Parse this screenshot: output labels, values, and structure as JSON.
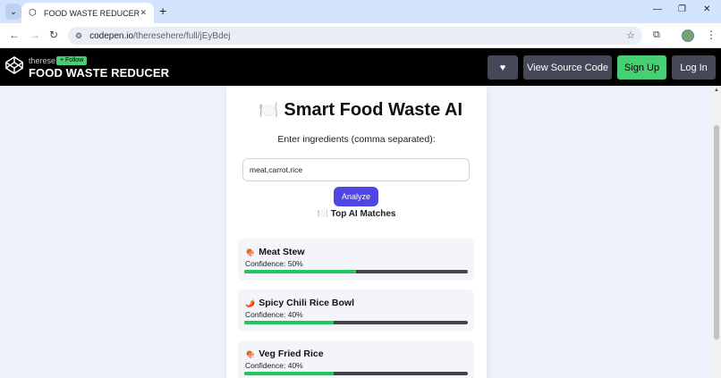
{
  "browser": {
    "tab_title": "FOOD WASTE REDUCER",
    "url_host": "codepen.io",
    "url_path": "/theresehere/full/jEyBdej"
  },
  "header": {
    "username": "therese",
    "follow_label": "+ Follow",
    "pen_title": "FOOD WASTE REDUCER",
    "view_source_label": "View Source Code",
    "signup_label": "Sign Up",
    "login_label": "Log In"
  },
  "app": {
    "title_emoji": "🍽️",
    "title": "Smart Food Waste AI",
    "prompt": "Enter ingredients (comma separated):",
    "input_value": "meat,carrot,rice",
    "analyze_label": "Analyze",
    "matches_title": "🍽️ Top AI Matches",
    "results": [
      {
        "icon": "🍖",
        "name": "Meat Stew",
        "confidence_text": "Confidence: 50%",
        "confidence": 0.5
      },
      {
        "icon": "🌶️",
        "name": "Spicy Chili Rice Bowl",
        "confidence_text": "Confidence: 40%",
        "confidence": 0.4
      },
      {
        "icon": "🍖",
        "name": "Veg Fried Rice",
        "confidence_text": "Confidence: 40%",
        "confidence": 0.4
      }
    ]
  },
  "colors": {
    "accent": "#4f46e5",
    "confidence_fill": "#22c55e",
    "codepen_green": "#47cf73"
  }
}
